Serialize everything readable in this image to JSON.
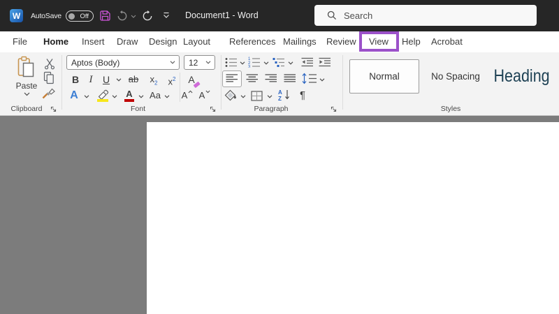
{
  "titlebar": {
    "autosave_label": "AutoSave",
    "autosave_state": "Off",
    "document_title": "Document1  -  Word",
    "search_placeholder": "Search"
  },
  "tabs": {
    "active_tab": "Home",
    "highlighted_tab": "View",
    "highlight_color": "#9b51c9",
    "items": [
      "File",
      "Home",
      "Insert",
      "Draw",
      "Design",
      "Layout",
      "References",
      "Mailings",
      "Review",
      "View",
      "Help",
      "Acrobat"
    ]
  },
  "ribbon": {
    "clipboard": {
      "label": "Clipboard",
      "paste": "Paste"
    },
    "font": {
      "label": "Font",
      "family": "Aptos (Body)",
      "size": "12",
      "bold": "B",
      "italic": "I",
      "underline": "U",
      "strikethrough": "ab",
      "subscript_base": "x",
      "subscript_digit": "2",
      "superscript_base": "x",
      "superscript_digit": "2",
      "clear_format": "A",
      "text_effects": "A",
      "font_color": "A",
      "change_case": "Aa",
      "grow": "A",
      "shrink": "A",
      "numbering_digits": [
        "1",
        "2",
        "3"
      ]
    },
    "paragraph": {
      "label": "Paragraph",
      "sort_a": "A",
      "sort_z": "Z",
      "pilcrow": "¶"
    },
    "styles": {
      "label": "Styles",
      "selected": "Normal",
      "items": [
        "Normal",
        "No Spacing",
        "Heading"
      ],
      "heading_color": "#1e4154"
    }
  },
  "colors": {
    "titlebar_bg": "#262626",
    "ribbon_bg": "#f3f3f3",
    "doc_bg": "#7c7c7c",
    "accent_purple": "#9b51c9",
    "save_icon": "#cf52dd",
    "highlight_yellow": "#f7e61b",
    "font_color_red": "#c00000",
    "blue_accent": "#2a63c0"
  }
}
